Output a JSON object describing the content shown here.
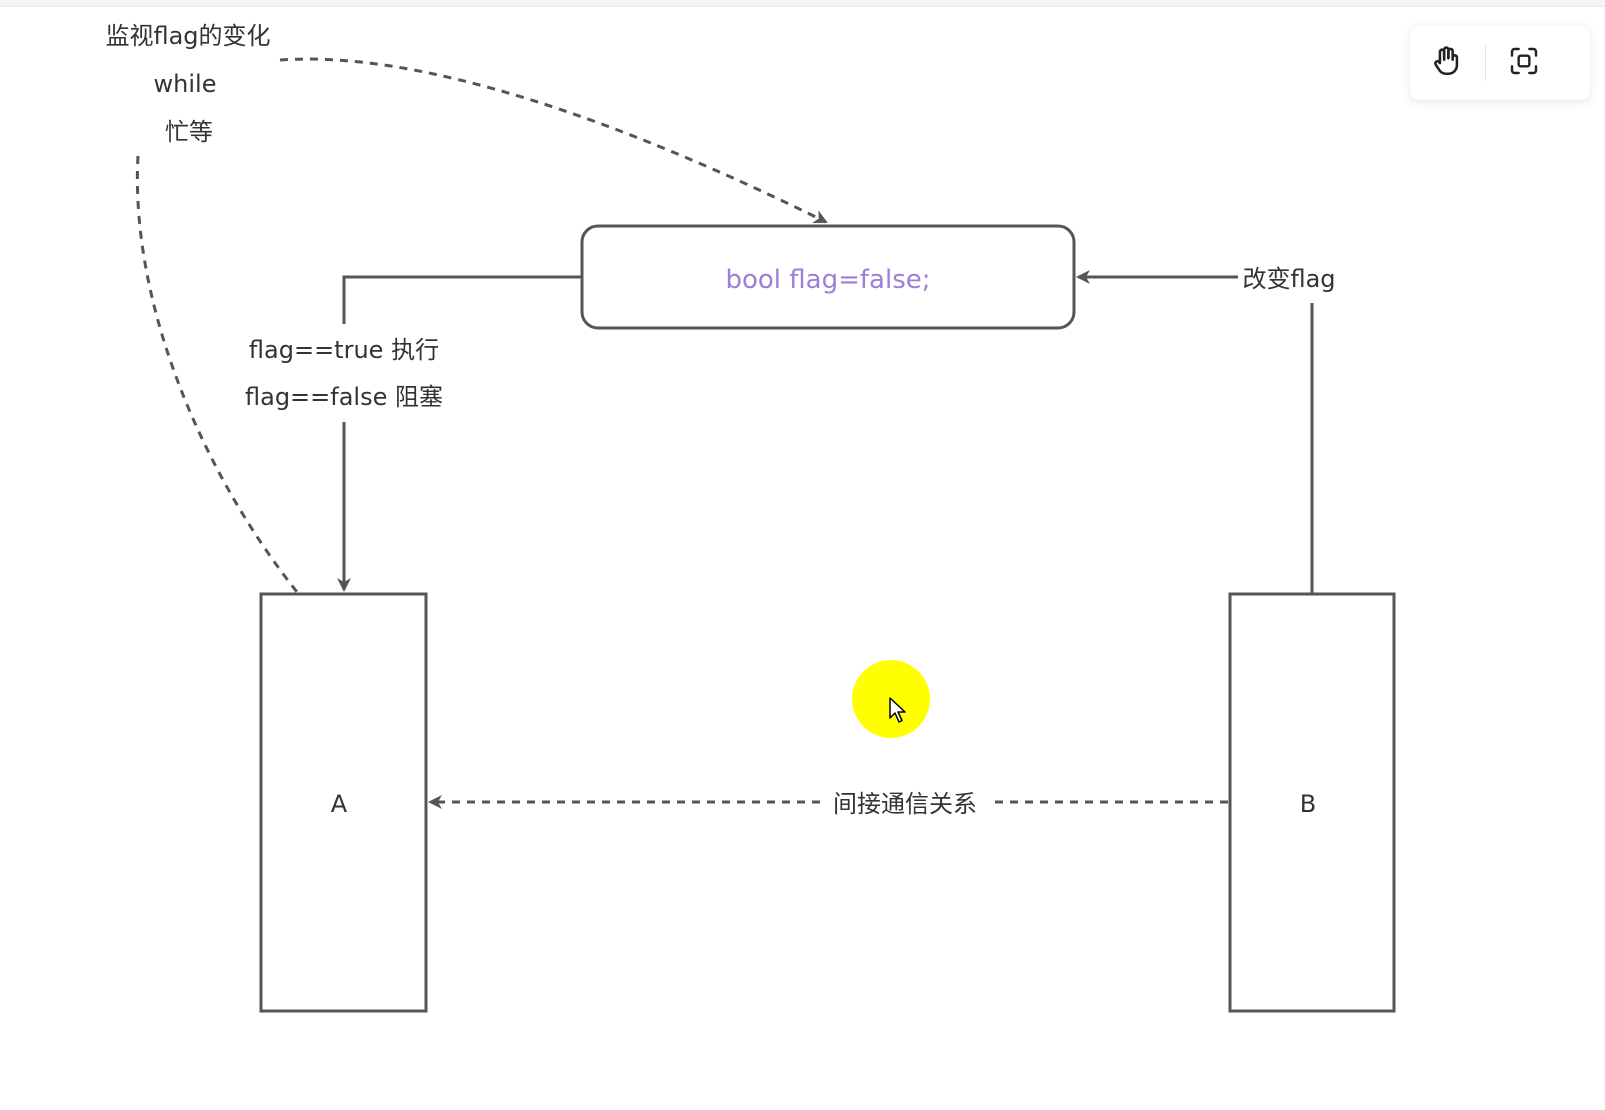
{
  "annotations": {
    "monitor": "监视flag的变化",
    "while": "while",
    "busy_wait": "忙等"
  },
  "flag_node": {
    "text": "bool  flag=false;",
    "text_color": "#9b7fd9"
  },
  "edges": {
    "change_flag": "改变flag",
    "true_exec": "flag==true 执行",
    "false_block": "flag==false 阻塞",
    "indirect": "间接通信关系"
  },
  "nodes": {
    "a": "A",
    "b": "B"
  },
  "toolbar": {
    "hand_tool": "hand-icon",
    "focus_tool": "focus-frame-icon"
  },
  "colors": {
    "stroke": "#555555",
    "cursor_highlight": "#ffff00"
  }
}
